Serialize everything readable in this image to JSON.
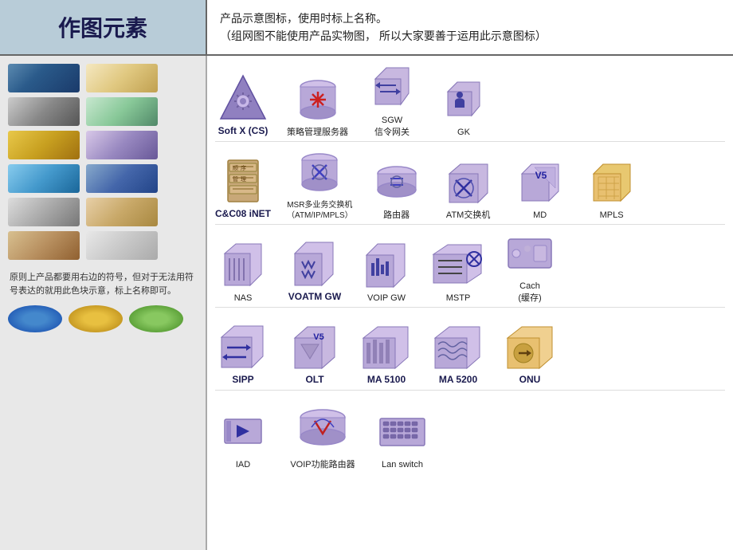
{
  "header": {
    "title": "作图元素",
    "desc1": "产品示意图标，使用时标上名称。",
    "desc2": "（组网图不能使用产品实物图，  所以大家要善于运用此示意图标）"
  },
  "left_note": "原则上产品都要用右边的符号，但对于无法用符号表达的就用此色块示意，标上名称即可。",
  "rows": [
    {
      "items": [
        {
          "label": "Soft X (CS)",
          "bold": true,
          "shape": "triangle_gear"
        },
        {
          "label": "策略管理服务器",
          "bold": false,
          "shape": "cylinder_star"
        },
        {
          "label": "SGW\n信令网关",
          "bold": false,
          "shape": "cube_arrows"
        },
        {
          "label": "GK",
          "bold": false,
          "shape": "cube_gk"
        }
      ]
    },
    {
      "items": [
        {
          "label": "C&C08 iNET",
          "bold": true,
          "shape": "server_stack"
        },
        {
          "label": "MSR多业务交换机\n（ATM/IP/MPLS）",
          "bold": false,
          "shape": "cylinder_cross"
        },
        {
          "label": "路由器",
          "bold": false,
          "shape": "cylinder_simple"
        },
        {
          "label": "ATM交换机",
          "bold": false,
          "shape": "cube_x"
        },
        {
          "label": "MD",
          "bold": false,
          "shape": "cube_v5"
        },
        {
          "label": "MPLS",
          "bold": false,
          "shape": "cube_mpls"
        }
      ]
    },
    {
      "items": [
        {
          "label": "NAS",
          "bold": false,
          "shape": "cube_nas"
        },
        {
          "label": "VOATM GW",
          "bold": true,
          "shape": "cube_voatm"
        },
        {
          "label": "VOIP GW",
          "bold": false,
          "shape": "cube_voip"
        },
        {
          "label": "MSTP",
          "bold": false,
          "shape": "cube_mstp"
        },
        {
          "label": "Cach\n(缓存)",
          "bold": false,
          "shape": "cube_cach"
        }
      ]
    },
    {
      "items": [
        {
          "label": "SIPP",
          "bold": true,
          "shape": "cube_sipp"
        },
        {
          "label": "OLT",
          "bold": true,
          "shape": "cube_olt"
        },
        {
          "label": "MA 5100",
          "bold": true,
          "shape": "cube_ma5100"
        },
        {
          "label": "MA 5200",
          "bold": true,
          "shape": "cube_ma5200"
        },
        {
          "label": "ONU",
          "bold": true,
          "shape": "cube_onu"
        }
      ]
    },
    {
      "items": [
        {
          "label": "IAD",
          "bold": false,
          "shape": "cube_iad"
        },
        {
          "label": "VOIP功能路由器",
          "bold": false,
          "shape": "cylinder_voip"
        },
        {
          "label": "Lan switch",
          "bold": false,
          "shape": "cube_lanswitch"
        }
      ]
    }
  ]
}
